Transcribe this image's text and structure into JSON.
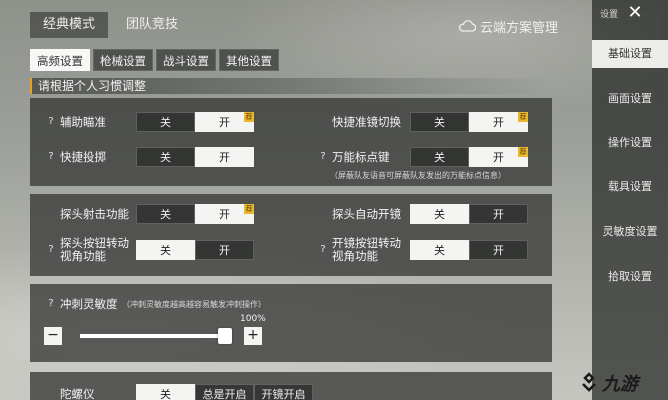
{
  "top_tabs": [
    {
      "label": "经典模式",
      "active": true
    },
    {
      "label": "团队竞技",
      "active": false
    }
  ],
  "cloud_manager": {
    "label": "云端方案管理",
    "icon": "cloud-icon"
  },
  "sub_tabs": [
    {
      "label": "高频设置",
      "active": true
    },
    {
      "label": "枪械设置",
      "active": false
    },
    {
      "label": "战斗设置",
      "active": false
    },
    {
      "label": "其他设置",
      "active": false
    }
  ],
  "section_title": "请根据个人习惯调整",
  "toggle_labels": {
    "off": "关",
    "on": "开",
    "recommend_badge": "荐"
  },
  "settings": {
    "aim_assist": {
      "help": "?",
      "label": "辅助瞄准",
      "value": "开",
      "recommended": true
    },
    "quick_scope_switch": {
      "label": "快捷准镜切换",
      "value": "开",
      "recommended": true
    },
    "quick_throw": {
      "help": "?",
      "label": "快捷投掷",
      "value": "开"
    },
    "universal_marker": {
      "help": "?",
      "label": "万能标点键",
      "value": "开",
      "recommended": true,
      "note": "（屏蔽队友语音可屏蔽队友发出的万能标点信息）"
    },
    "peek_fire": {
      "label": "探头射击功能",
      "value": "开",
      "recommended": true
    },
    "peek_auto_scope": {
      "label": "探头自动开镜",
      "value": "关"
    },
    "peek_button_rotate": {
      "help": "?",
      "label": "探头按钮转动视角功能",
      "value": "关"
    },
    "scope_button_rotate": {
      "help": "?",
      "label": "开镜按钮转动视角功能",
      "value": "关"
    }
  },
  "sprint_sensitivity": {
    "help": "?",
    "label": "冲刺灵敏度",
    "hint": "（冲刺灵敏度越高越容易触发冲刺操作）",
    "value_percent": 100,
    "value_label": "100%",
    "minus": "−",
    "plus": "+"
  },
  "gyroscope": {
    "label": "陀螺仪",
    "options": [
      "关",
      "总是开启",
      "开镜开启"
    ],
    "selected": "关"
  },
  "side_menu": {
    "title": "设置",
    "close": "✕",
    "items": [
      {
        "label": "基础设置",
        "active": true
      },
      {
        "label": "画面设置",
        "active": false
      },
      {
        "label": "操作设置",
        "active": false
      },
      {
        "label": "载具设置",
        "active": false
      },
      {
        "label": "灵敏度设置",
        "active": false
      },
      {
        "label": "拾取设置",
        "active": false
      }
    ]
  },
  "watermark": {
    "text": "九游"
  },
  "colors": {
    "badge": "#e8b830",
    "section_accent": "#f0a020",
    "selected_segment": "#f4f4f2"
  }
}
